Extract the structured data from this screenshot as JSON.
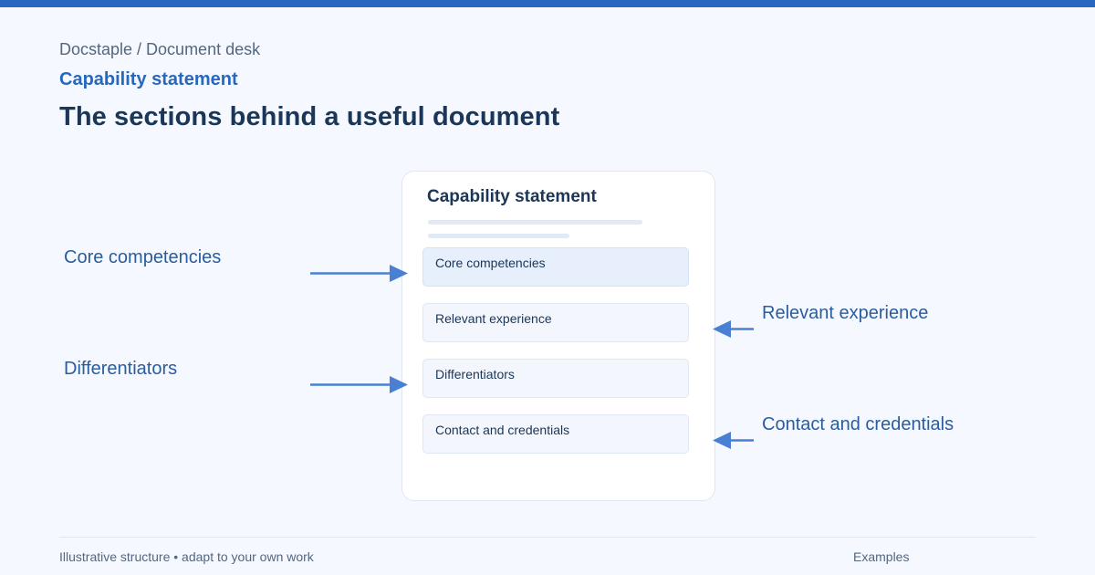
{
  "header": {
    "breadcrumb": "Docstaple / Document desk",
    "eyebrow": "Capability statement",
    "title": "The sections behind a useful document"
  },
  "document": {
    "title": "Capability statement",
    "sections": [
      "Core competencies",
      "Relevant experience",
      "Differentiators",
      "Contact and credentials"
    ]
  },
  "callouts": {
    "left": [
      "Core competencies",
      "Differentiators"
    ],
    "right": [
      "Relevant experience",
      "Contact and credentials"
    ]
  },
  "footer": {
    "note": "Illustrative structure • adapt to your own work",
    "link": "Examples"
  },
  "colors": {
    "accent": "#2767bf",
    "arrow": "#4a80d4",
    "heading": "#1b3656",
    "background": "#f5f9ff"
  }
}
